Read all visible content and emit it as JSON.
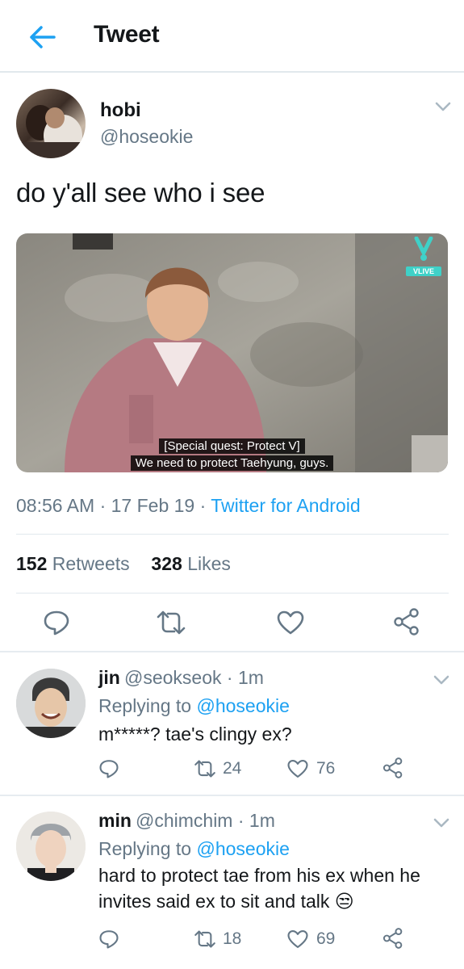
{
  "header": {
    "title": "Tweet"
  },
  "tweet": {
    "author_name": "hobi",
    "author_handle": "@hoseokie",
    "text": "do y'all see who i see",
    "video_overlay": {
      "badge": "VLIVE",
      "subtitle_line1": "[Special quest: Protect V]",
      "subtitle_line2": "We need to protect Taehyung, guys."
    },
    "time": "08:56 AM",
    "date": "17 Feb 19",
    "source": "Twitter for Android",
    "retweets_count": "152",
    "retweets_label": "Retweets",
    "likes_count": "328",
    "likes_label": "Likes"
  },
  "replies": [
    {
      "name": "jin",
      "handle_time": "@seokseok · 1m",
      "replying_prefix": "Replying to",
      "replying_to": "@hoseokie",
      "text_line1": "m*****? tae's clingy ex?",
      "text_line2": "",
      "retweets": "24",
      "likes": "76"
    },
    {
      "name": "min",
      "handle_time": "@chimchim · 1m",
      "replying_prefix": "Replying to",
      "replying_to": "@hoseokie",
      "text_line1": "hard to protect tae from his ex when he",
      "text_line2": "invites said ex to sit and talk",
      "emoji": "😒",
      "retweets": "18",
      "likes": "69"
    }
  ],
  "colors": {
    "accent": "#1da1f2",
    "secondary_text": "#657786",
    "primary_text": "#14171a",
    "divider": "#e1e8ed"
  },
  "icons": [
    "back-arrow-icon",
    "chevron-down-icon",
    "reply-icon",
    "retweet-icon",
    "like-icon",
    "share-icon",
    "vlive-logo"
  ]
}
